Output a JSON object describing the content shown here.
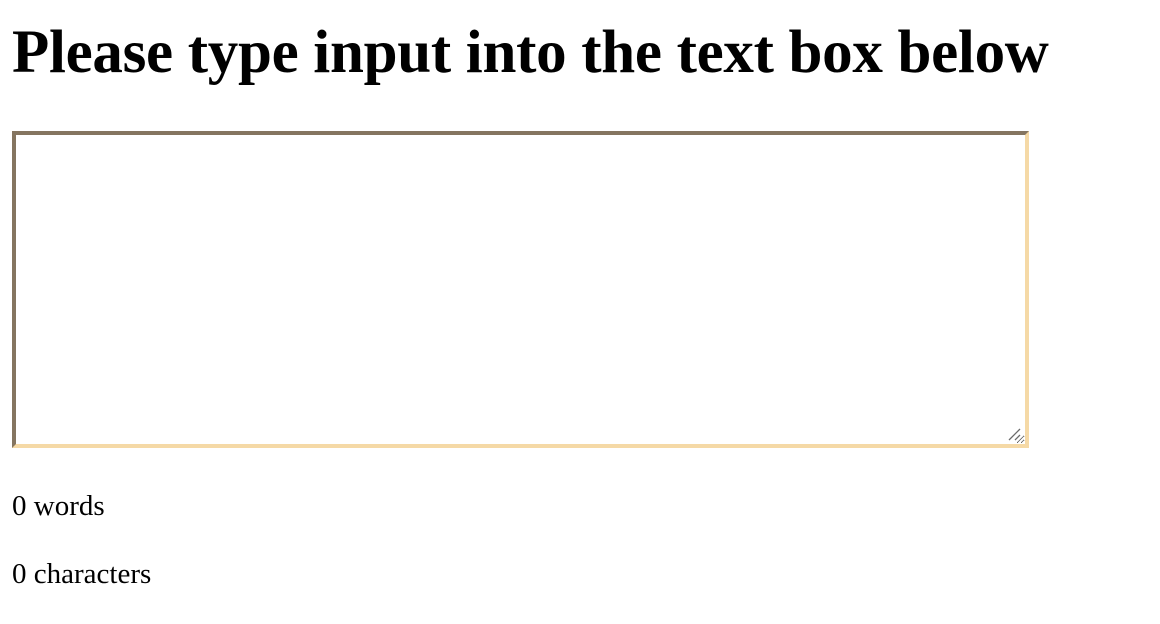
{
  "heading": "Please type input into the text box below",
  "textbox": {
    "value": "",
    "placeholder": ""
  },
  "stats": {
    "words_text": "0 words",
    "characters_text": "0 characters"
  },
  "colors": {
    "border_dark": "#857560",
    "border_light": "#f5d9a6"
  },
  "icons": {
    "resize_handle": "resize-grip-icon"
  }
}
